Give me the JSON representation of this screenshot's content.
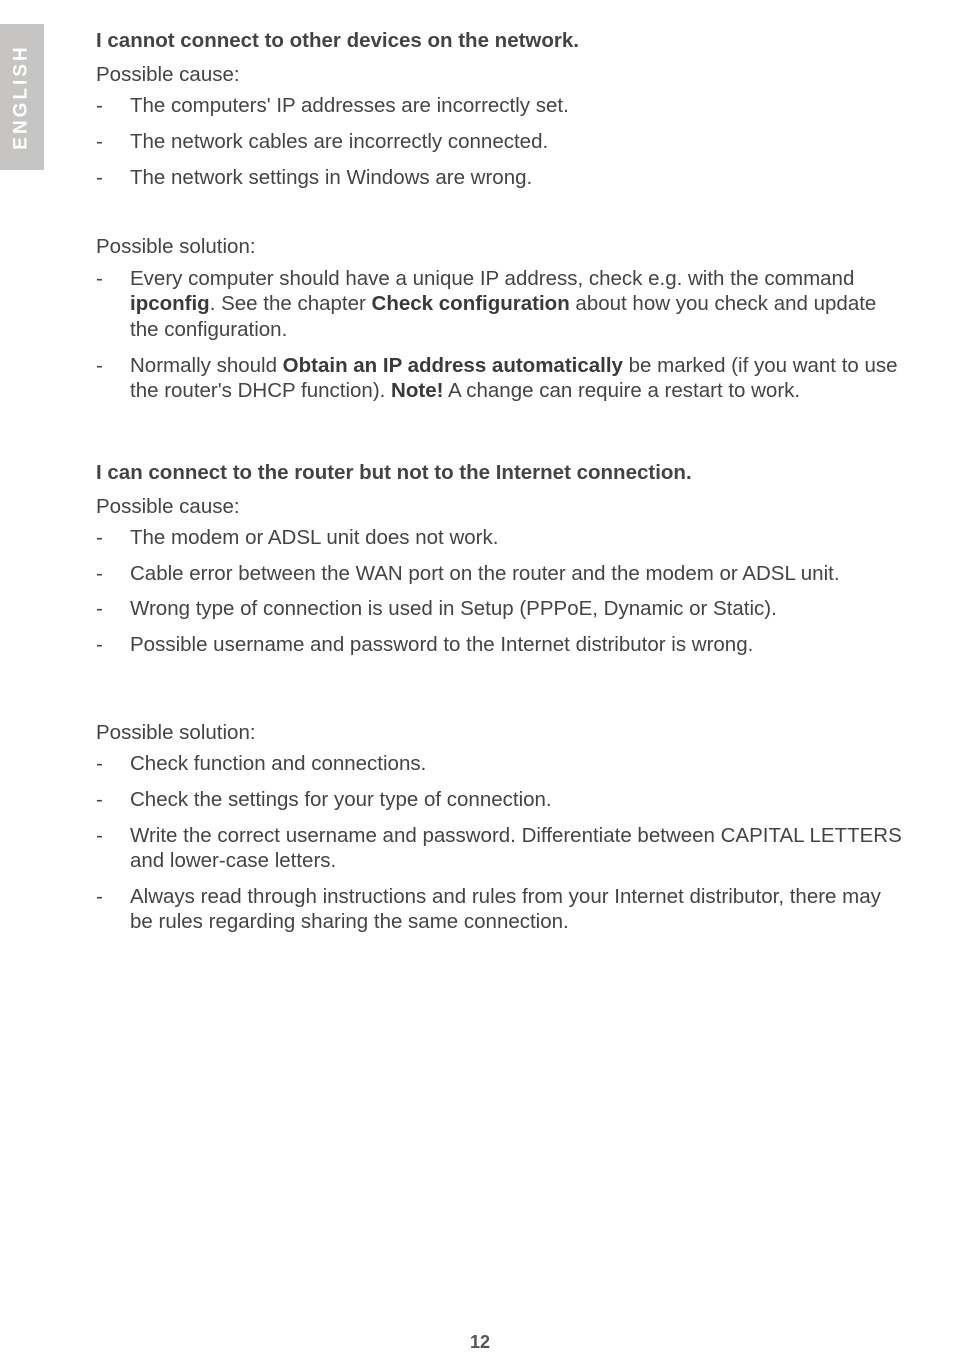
{
  "tab": {
    "label": "ENGLISH"
  },
  "dash": "-",
  "section1": {
    "heading": "I cannot connect to other devices on the network.",
    "cause_label": "Possible cause:",
    "causes": [
      "The computers' IP addresses are incorrectly set.",
      "The network cables are incorrectly connected.",
      "The network settings in Windows are wrong."
    ],
    "solution_label": "Possible solution:",
    "sol1": {
      "pre": "Every computer should have a unique IP address, check e.g. with the command ",
      "b1": "ipconfig",
      "mid1": ". See the chapter ",
      "b2": "Check configuration",
      "post": " about how you check and update the configuration."
    },
    "sol2": {
      "pre": "Normally should ",
      "b1": "Obtain an IP address automatically",
      "mid": " be marked (if you want to use the router's DHCP function). ",
      "b2": "Note!",
      "post": " A change can require a restart to work."
    }
  },
  "section2": {
    "heading": "I can connect to the router but not to the Internet connection.",
    "cause_label": "Possible cause:",
    "causes": [
      "The modem or ADSL unit does not work.",
      "Cable error between the WAN port on the router and the modem or ADSL unit.",
      "Wrong type of connection is used in Setup (PPPoE, Dynamic or Static).",
      "Possible username and password to the Internet distributor is wrong."
    ],
    "solution_label": "Possible solution:",
    "solutions": [
      "Check function and connections.",
      "Check the settings for your type of connection.",
      "Write the correct username and password.  Differentiate between CAPITAL LETTERS and lower-case letters.",
      "Always read through instructions and rules from your Internet distributor, there may be rules regarding sharing the same connection."
    ]
  },
  "page_number": "12"
}
